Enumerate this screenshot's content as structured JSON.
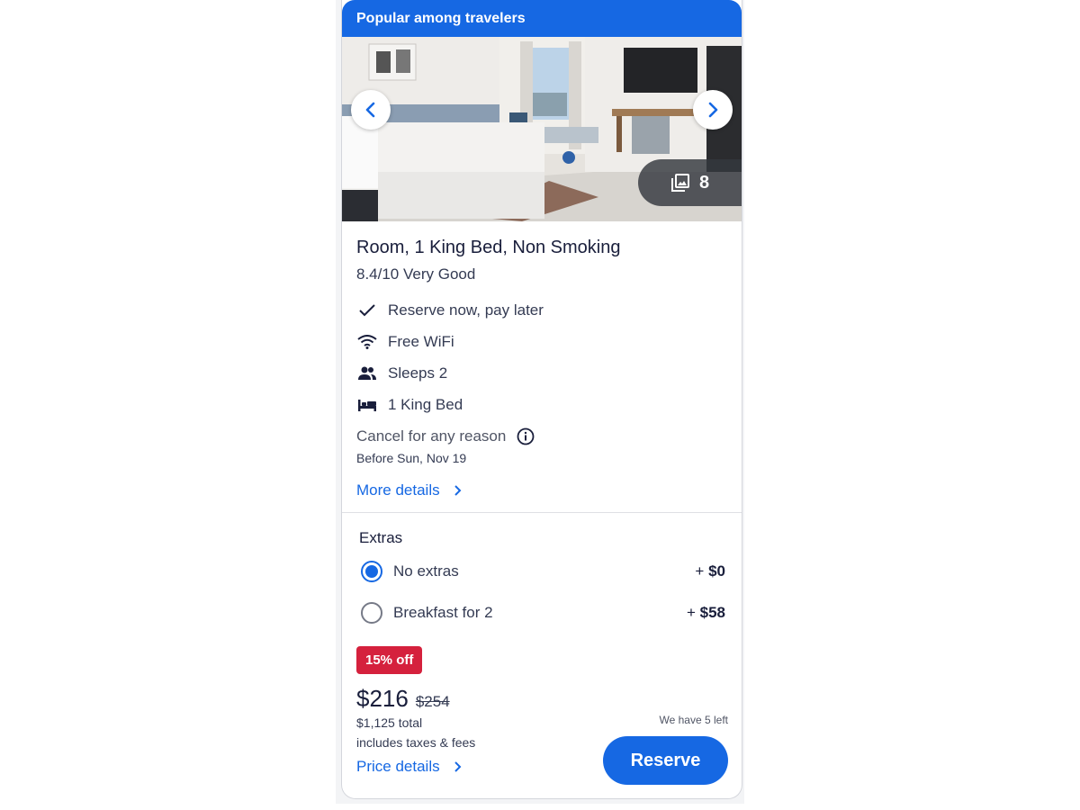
{
  "card": {
    "banner": "Popular among travelers",
    "gallery": {
      "photo_count": "8",
      "prev_icon": "chevron-left-icon",
      "next_icon": "chevron-right-icon",
      "count_icon": "image-gallery-icon"
    },
    "room_title": "Room, 1 King Bed, Non Smoking",
    "rating": "8.4/10 Very Good",
    "amenities": [
      {
        "icon": "check-icon",
        "label": "Reserve now, pay later"
      },
      {
        "icon": "wifi-icon",
        "label": "Free WiFi"
      },
      {
        "icon": "people-icon",
        "label": "Sleeps 2"
      },
      {
        "icon": "bed-icon",
        "label": "1 King Bed"
      }
    ],
    "cancellation": {
      "label": "Cancel for any reason",
      "date": "Before Sun, Nov 19"
    },
    "more_details": "More details",
    "extras": {
      "label": "Extras",
      "options": [
        {
          "label": "No extras",
          "price_prefix": "+",
          "price": "$0",
          "selected": true
        },
        {
          "label": "Breakfast for 2",
          "price_prefix": "+",
          "price": "$58",
          "selected": false
        }
      ]
    },
    "pricing": {
      "badge": "15% off",
      "price": "$216",
      "original_price": "$254",
      "total": "$1,125 total",
      "taxes_note": "includes taxes & fees",
      "price_details": "Price details",
      "availability": "We have 5 left",
      "reserve_label": "Reserve"
    },
    "colors": {
      "brand_blue": "#1668e3",
      "deal_red": "#d5213d",
      "text_dark": "#191e3b"
    }
  }
}
